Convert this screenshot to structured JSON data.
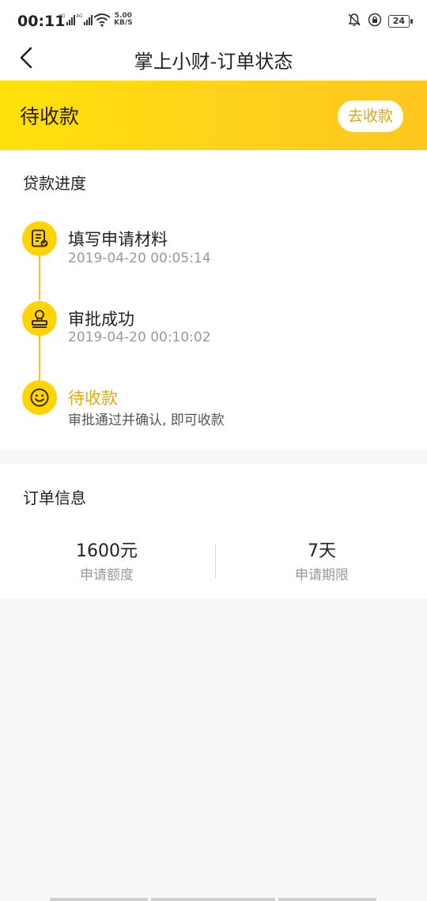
{
  "status_bar": {
    "time": "00:11",
    "signal_1_type": "2G",
    "signal_2_type": "4G",
    "speed_value": "5.00",
    "speed_unit": "KB/S",
    "battery": "24"
  },
  "nav": {
    "title": "掌上小财-订单状态"
  },
  "banner": {
    "status": "待收款",
    "action_label": "去收款"
  },
  "progress": {
    "title": "贷款进度",
    "steps": [
      {
        "title": "填写申请材料",
        "subtitle": "2019-04-20 00:05:14",
        "icon": "document-check-icon"
      },
      {
        "title": "审批成功",
        "subtitle": "2019-04-20 00:10:02",
        "icon": "stamp-icon"
      },
      {
        "title": "待收款",
        "subtitle": "审批通过并确认, 即可收款",
        "icon": "smile-icon"
      }
    ]
  },
  "order": {
    "title": "订单信息",
    "amount_value": "1600元",
    "amount_label": "申请额度",
    "term_value": "7天",
    "term_label": "申请期限"
  },
  "colors": {
    "accent_yellow": "#ffd400",
    "accent_text": "#e3a90a",
    "timeline": "#f3c322"
  }
}
